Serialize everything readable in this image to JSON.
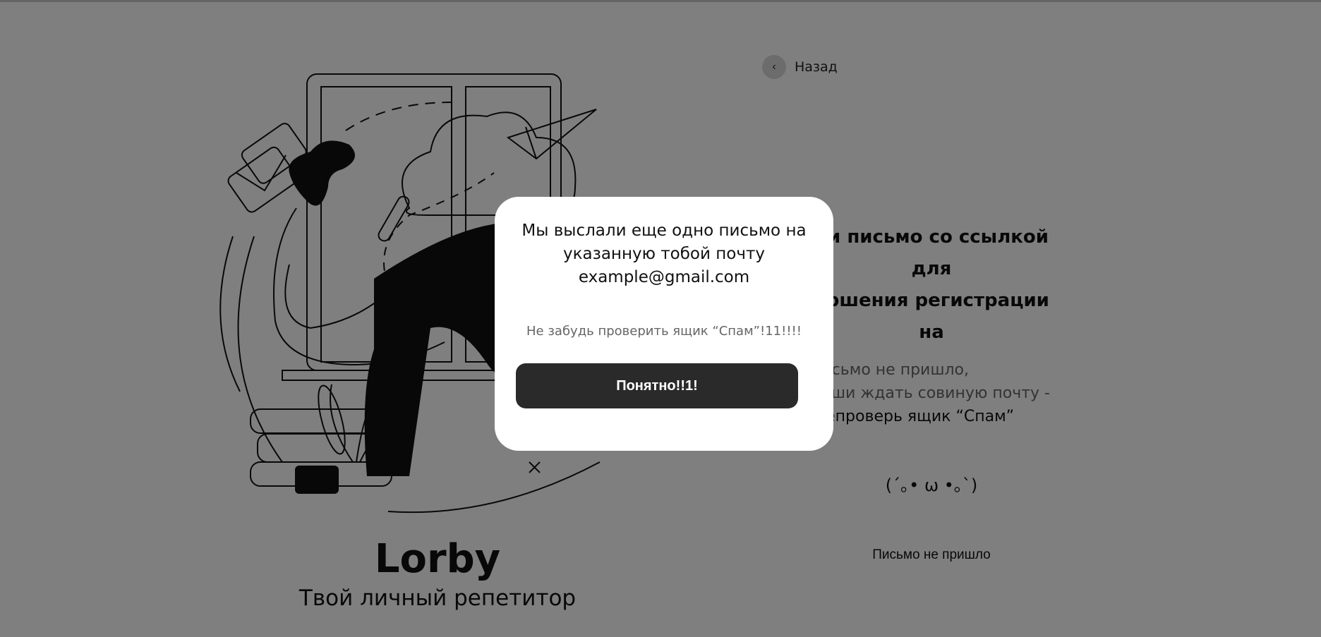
{
  "brand": {
    "title": "Lorby",
    "subtitle": "Твой личный репетитор"
  },
  "back": {
    "icon": "chevron-left-icon",
    "glyph": "‹",
    "label": "Назад"
  },
  "main": {
    "heading_lines": [
      "ли письмо со ссылкой для",
      "ершения регистрации",
      "на"
    ],
    "hint_lines": [
      "письмо не пришло,",
      "пеши ждать совиную почту -",
      "шепроверь ящик “Спам”"
    ],
    "hint_dark_part": "проверь ящик “Спам”",
    "kaomoji": "(´｡• ω •｡`)",
    "resend_link": "Письмо не пришло"
  },
  "modal": {
    "title_lines": [
      "Мы выслали еще одно письмо на",
      "указанную тобой почту",
      "example@gmail.com"
    ],
    "note": "Не забудь проверить ящик “Спам”!11!!!!",
    "button_label": "Понятно!!1!"
  },
  "colors": {
    "overlay": "#808080",
    "button_bg": "#2a2a2a",
    "modal_bg": "#ffffff"
  }
}
